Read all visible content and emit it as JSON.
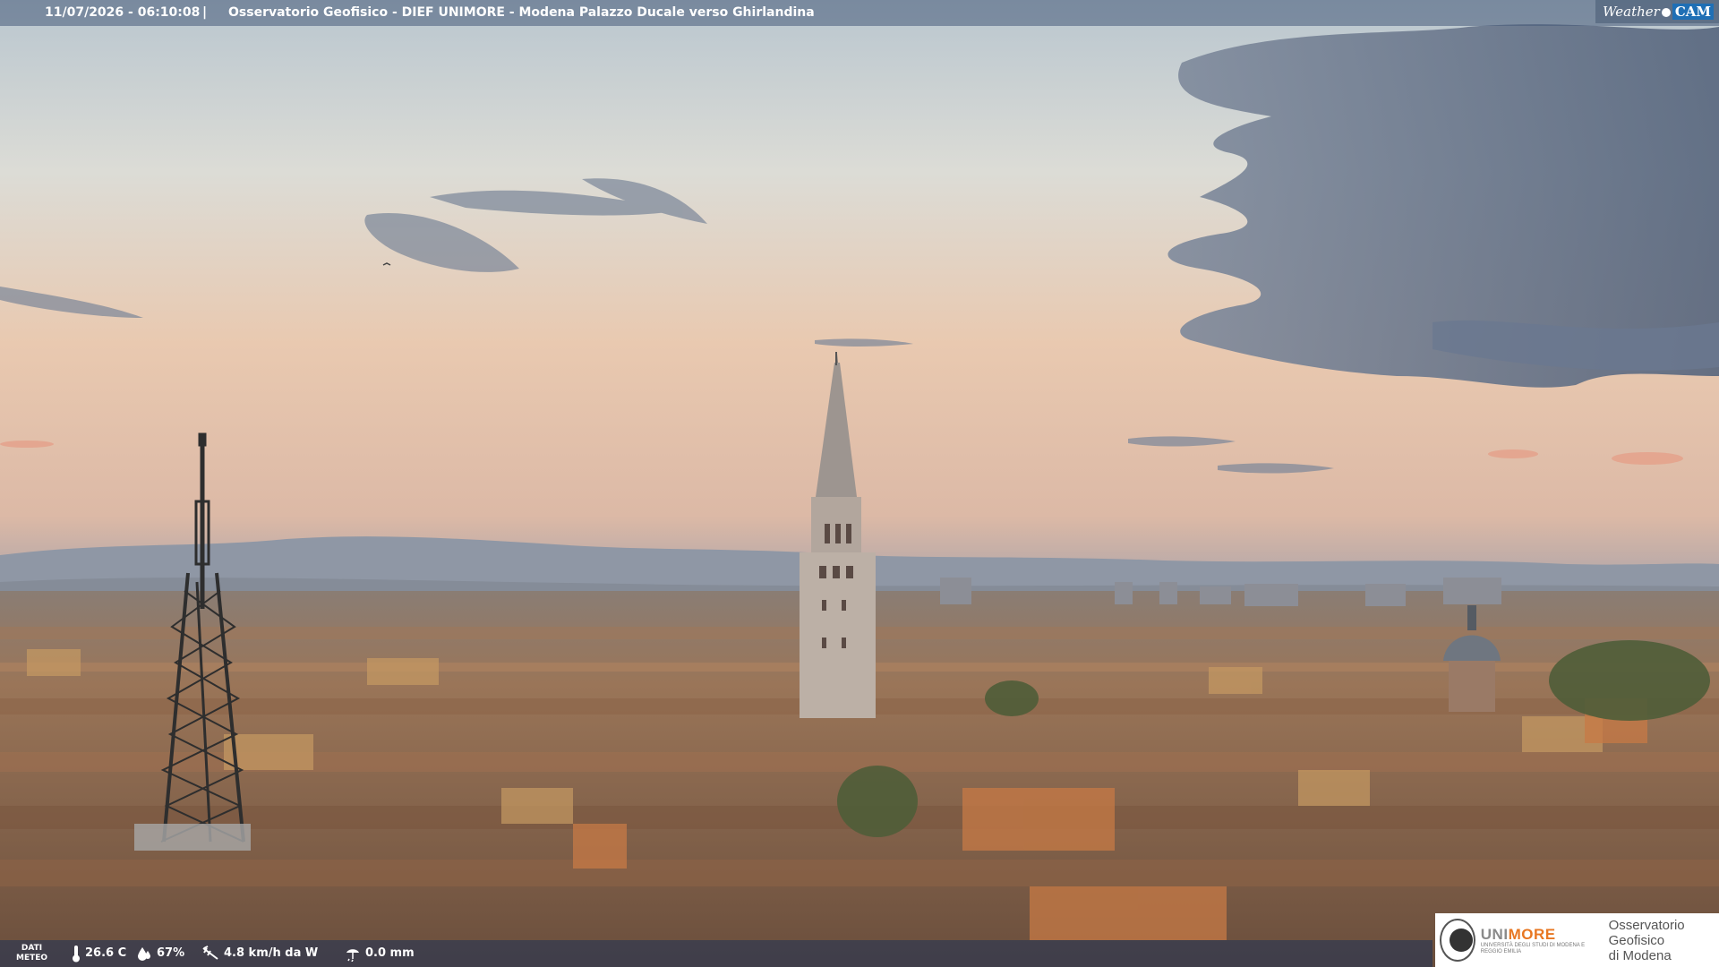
{
  "top_bar": {
    "timestamp": "11/07/2026 - 06:10:08",
    "separator": "|",
    "title": "Osservatorio Geofisico - DIEF UNIMORE - Modena Palazzo Ducale verso Ghirlandina"
  },
  "brand": {
    "weather": "Weather",
    "cam": "CAM"
  },
  "bottom_bar": {
    "label_line1": "DATI",
    "label_line2": "METEO",
    "temperature": "26.6 C",
    "humidity": "67%",
    "wind": "4.8 km/h da W",
    "rain": "0.0 mm",
    "icons": [
      "thermometer-icon",
      "humidity-drop-icon",
      "wind-icon",
      "rain-gauge-icon"
    ]
  },
  "logo": {
    "university_name_part1": "UNI",
    "university_name_part2": "MORE",
    "university_subtitle": "UNIVERSITÀ DEGLI STUDI DI MODENA E REGGIO EMILIA",
    "observatory_line1": "Osservatorio Geofisico",
    "observatory_line2": "di Modena"
  },
  "colors": {
    "unimore_orange": "#e87722",
    "cam_blue": "#1f6fb5",
    "sky_top": "#b9c6cf",
    "sky_horizon": "#e9c3a6",
    "cloud": "#5e6e86"
  }
}
